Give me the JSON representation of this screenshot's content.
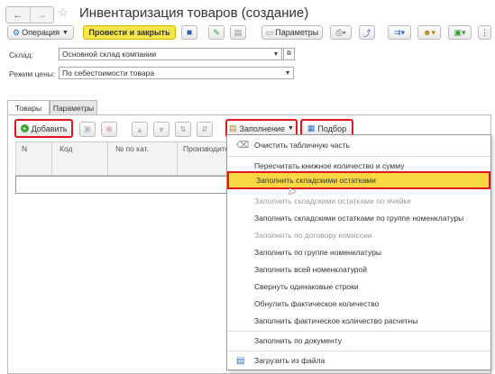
{
  "window": {
    "title": "Инвентаризация товаров (создание)",
    "nav_back": "←",
    "nav_forward": "→",
    "favorite": "☆"
  },
  "toolbar": {
    "operation_label": "Операция",
    "post_and_close_label": "Провести и закрыть",
    "parameters_label": "Параметры"
  },
  "form": {
    "warehouse_label": "Склад:",
    "warehouse_value": "Основной склад компании",
    "price_mode_label": "Режим цены:",
    "price_mode_value": "По себестоимости товара"
  },
  "tabs": [
    {
      "label": "Товары",
      "active": true
    },
    {
      "label": "Параметры",
      "active": false
    }
  ],
  "table_toolbar": {
    "add_label": "Добавить",
    "fill_label": "Заполнение",
    "selection_label": "Подбор"
  },
  "table": {
    "columns": [
      "N",
      "Код",
      "№ по кат.",
      "Производите"
    ]
  },
  "fill_menu": {
    "items": [
      {
        "label": "Очистить табличную часть",
        "enabled": true,
        "icon": "clear-table-icon"
      },
      {
        "label": "Пересчитать книжное количество и сумму",
        "enabled": true
      },
      {
        "label": "Заполнить складскими остатками",
        "enabled": true,
        "highlighted": true
      },
      {
        "label": "Заполнить складскими остатками по ячейке",
        "enabled": false
      },
      {
        "label": "Заполнить складскими остатками по группе номенклатуры",
        "enabled": true
      },
      {
        "label": "Заполнить по договору комиссии",
        "enabled": false
      },
      {
        "label": "Заполнить по группе номенклатуры",
        "enabled": true
      },
      {
        "label": "Заполнить всей номенклатурой",
        "enabled": true
      },
      {
        "label": "Свернуть одинаковые строки",
        "enabled": true
      },
      {
        "label": "Обнулить фактическое количество",
        "enabled": true
      },
      {
        "label": "Заполнить фактическое количество расчетны",
        "enabled": true
      },
      {
        "label": "Заполнить по документу",
        "enabled": true
      },
      {
        "label": "Загрузить из файла",
        "enabled": true,
        "icon": "load-file-icon"
      }
    ]
  },
  "colors": {
    "highlight_red": "#e0181e",
    "primary_yellow": "#f5e64a",
    "menu_highlight": "#f7d843",
    "add_green": "#3aa33a"
  }
}
